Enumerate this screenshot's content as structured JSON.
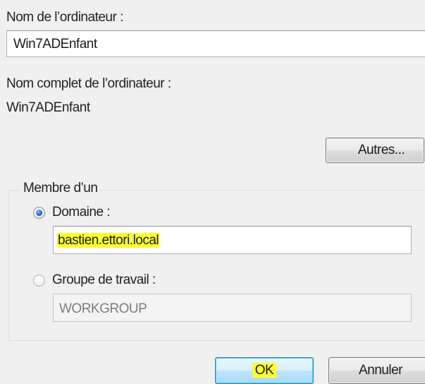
{
  "computer_name": {
    "label": "Nom de l’ordinateur :",
    "value": "Win7ADEnfant"
  },
  "full_computer_name": {
    "label": "Nom complet de l’ordinateur :",
    "value": "Win7ADEnfant"
  },
  "more_button": {
    "label": "Autres..."
  },
  "member_of": {
    "legend": "Membre d’un",
    "domain": {
      "label": "Domaine :",
      "value": "bastien.ettori.local",
      "selected": true
    },
    "workgroup": {
      "label": "Groupe de travail :",
      "value": "WORKGROUP",
      "selected": false
    }
  },
  "buttons": {
    "ok": "OK",
    "cancel": "Annuler"
  },
  "colors": {
    "highlight": "#ffff2d",
    "window_bg": "#f0f0f0",
    "default_button_border": "#3c7fb1"
  }
}
